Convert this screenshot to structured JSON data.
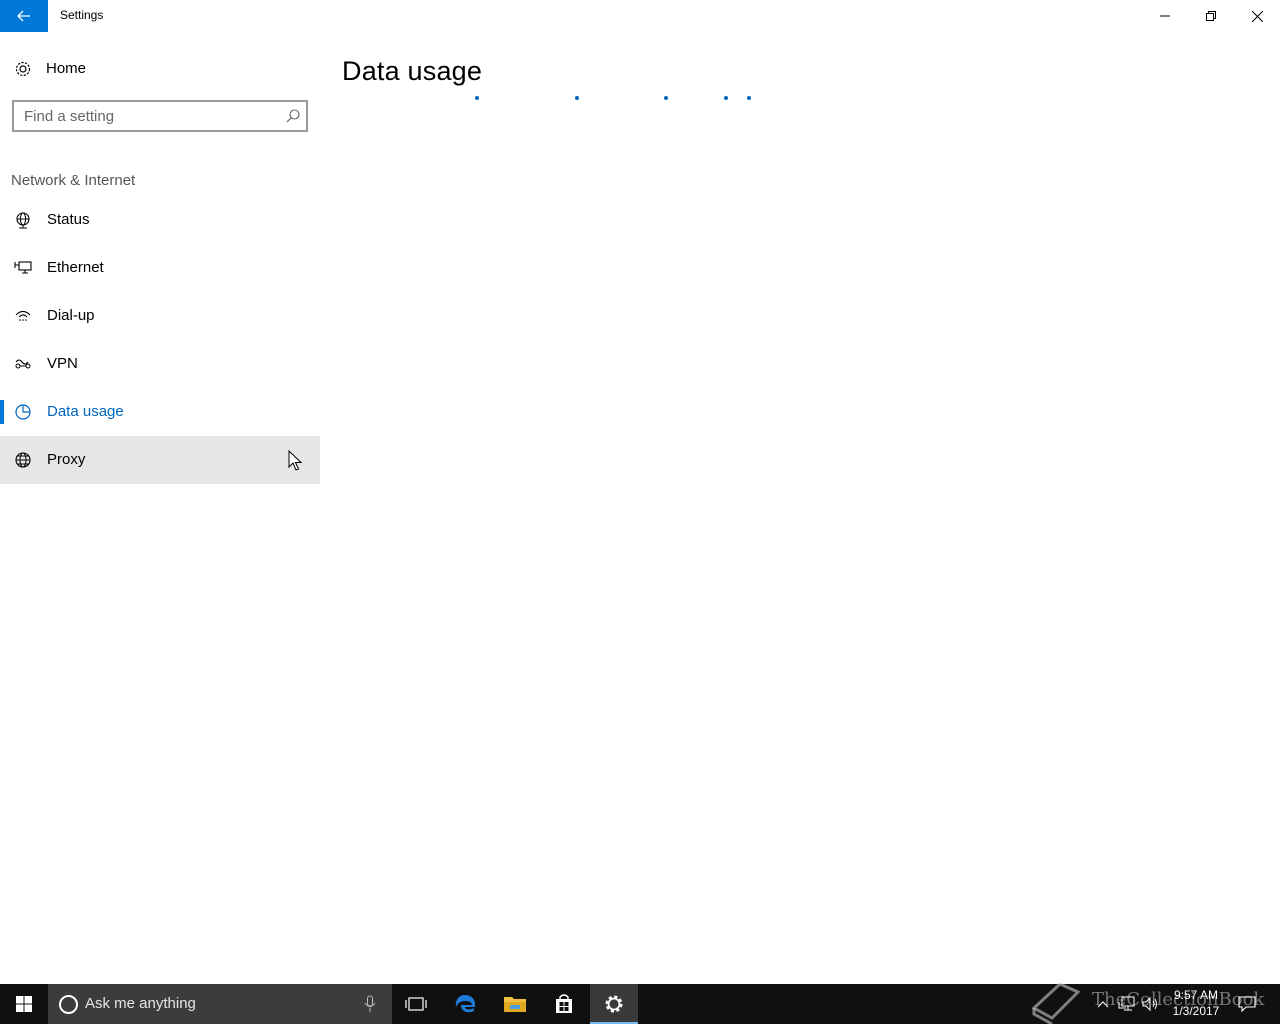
{
  "window": {
    "title": "Settings"
  },
  "sidebar": {
    "home_label": "Home",
    "search_placeholder": "Find a setting",
    "section_title": "Network & Internet",
    "items": [
      {
        "label": "Status",
        "icon": "status-globe-icon"
      },
      {
        "label": "Ethernet",
        "icon": "ethernet-icon"
      },
      {
        "label": "Dial-up",
        "icon": "dial-up-icon"
      },
      {
        "label": "VPN",
        "icon": "vpn-icon"
      },
      {
        "label": "Data usage",
        "icon": "data-usage-icon",
        "selected": true
      },
      {
        "label": "Proxy",
        "icon": "proxy-globe-icon",
        "hovered": true
      }
    ]
  },
  "main": {
    "page_title": "Data usage",
    "loading": true
  },
  "taskbar": {
    "search_placeholder": "Ask me anything",
    "pinned": [
      "task-view-icon",
      "edge-icon",
      "file-explorer-icon",
      "store-icon",
      "settings-icon"
    ],
    "active_app": "settings-icon",
    "clock_time": "9:57 AM",
    "clock_date": "1/3/2017",
    "watermark": "TheCollectionBook"
  },
  "colors": {
    "accent": "#0078d7",
    "selected_text": "#0067c0",
    "hover_bg": "#e6e6e6",
    "taskbar": "#101010"
  }
}
